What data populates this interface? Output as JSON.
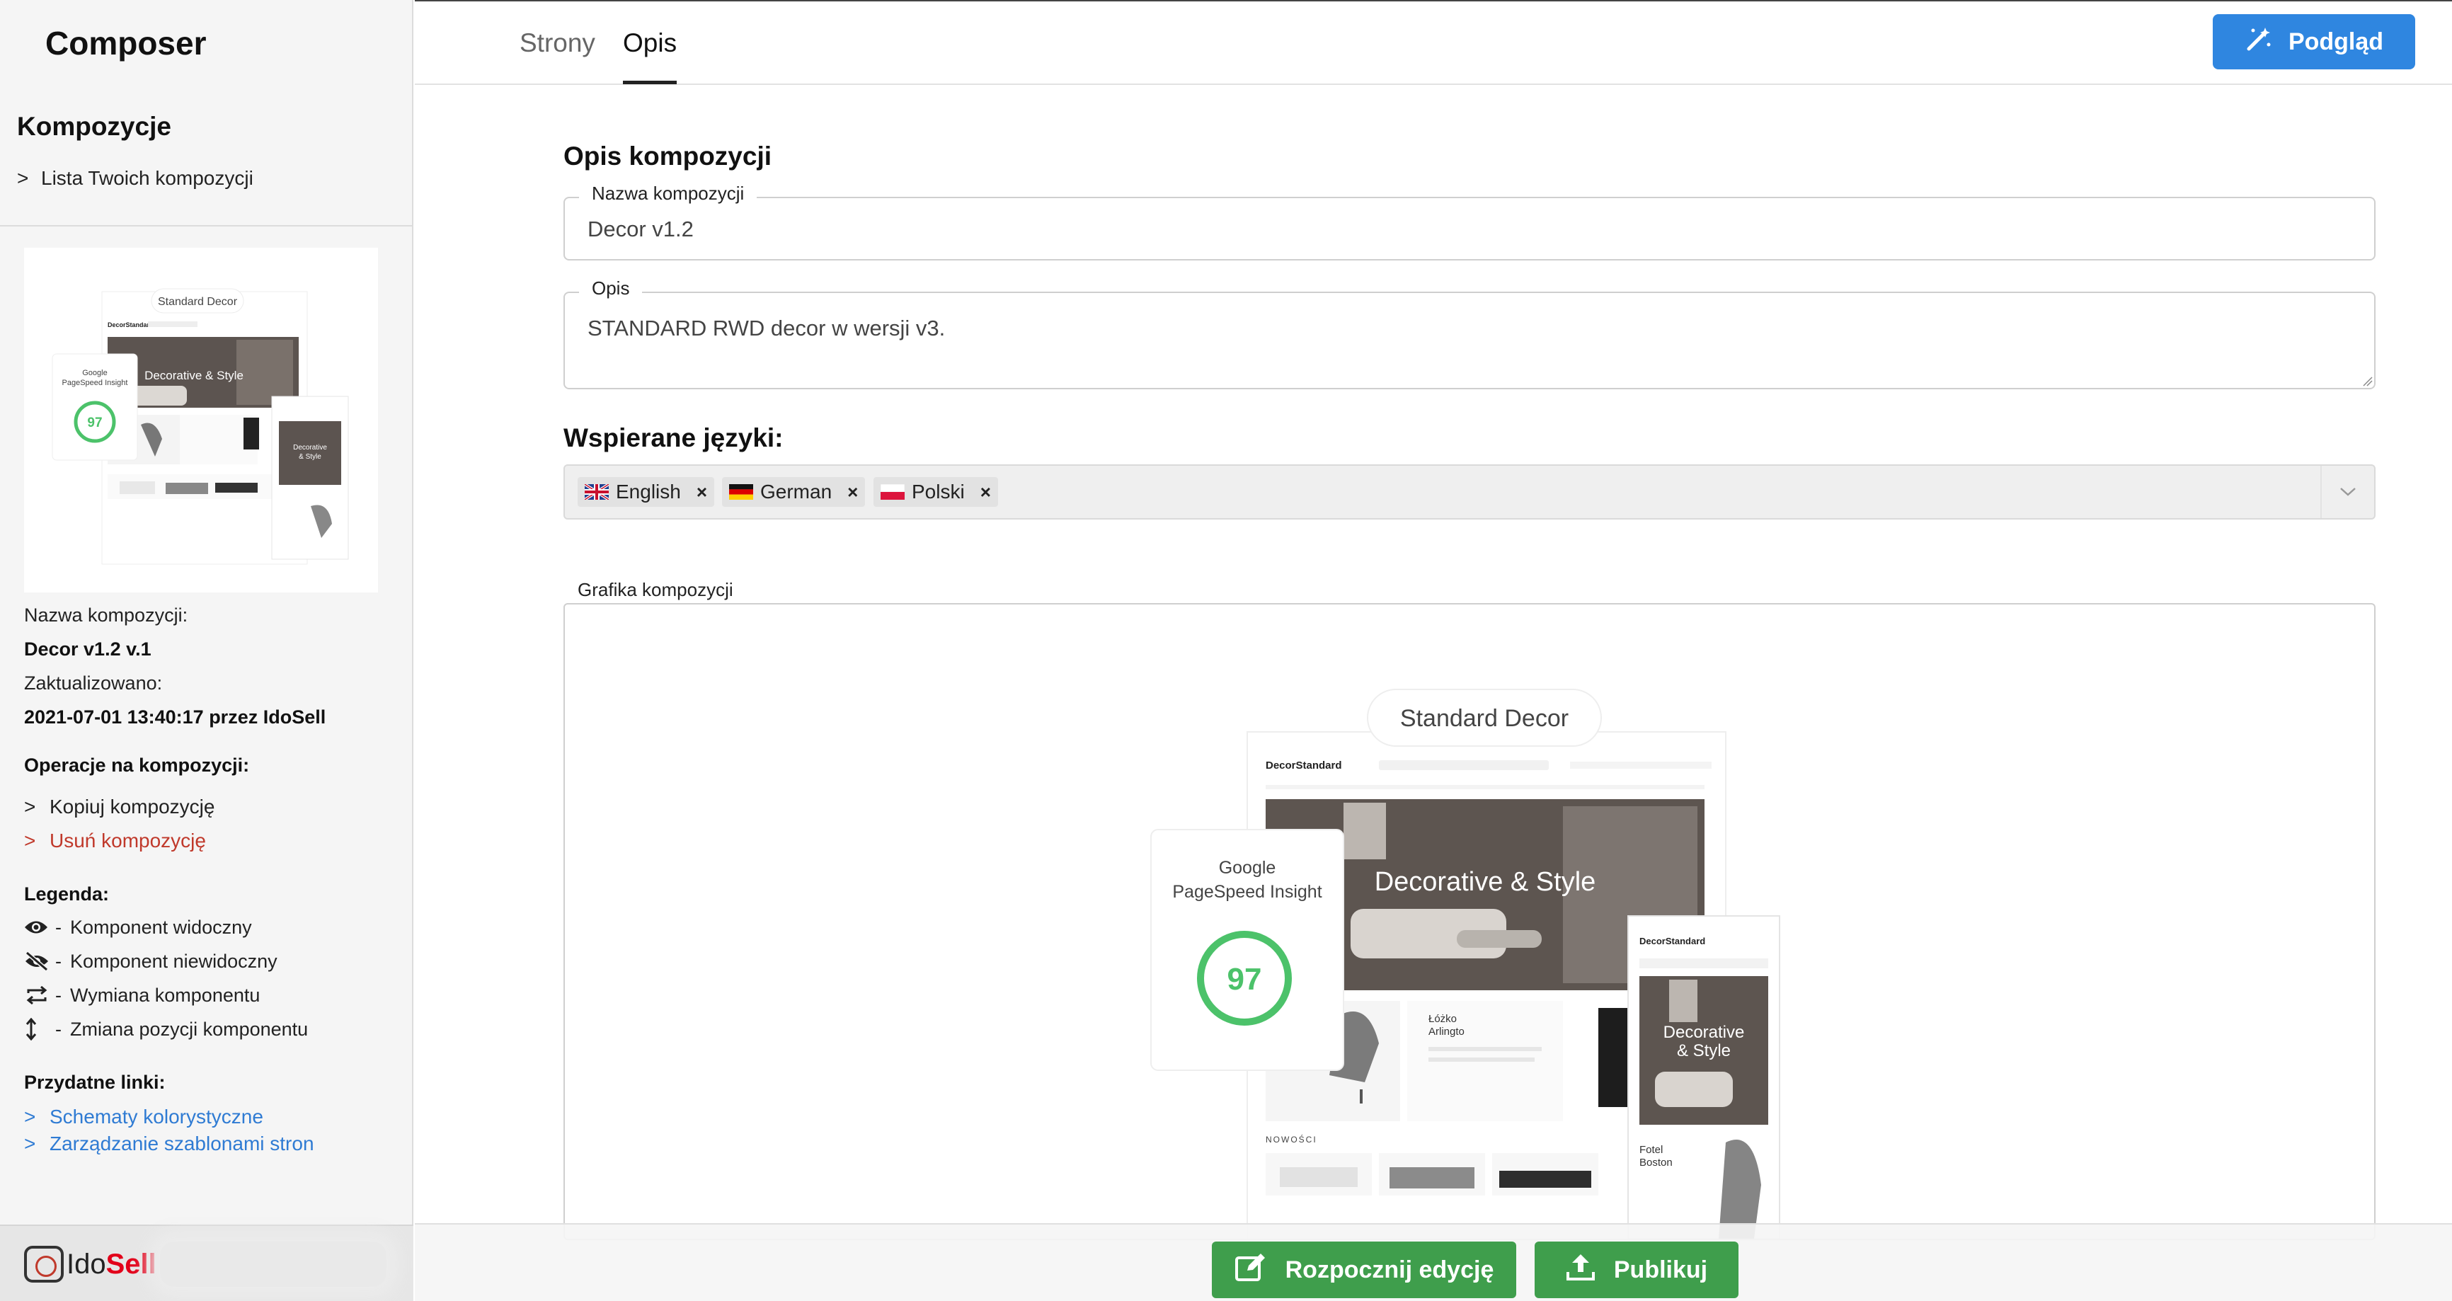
{
  "app": {
    "title": "Composer"
  },
  "sidebar": {
    "compositions_heading": "Kompozycje",
    "compositions_link": "Lista Twoich kompozycji",
    "thumbnail": {
      "title": "Standard Decor",
      "score_label_1": "Google",
      "score_label_2": "PageSpeed Insight",
      "score": "97",
      "hero_text": "Decorative & Style",
      "brand": "DecorStandard"
    },
    "name_label": "Nazwa kompozycji:",
    "name_value": "Decor v1.2 v.1",
    "updated_label": "Zaktualizowano:",
    "updated_value": "2021-07-01 13:40:17 przez IdoSell",
    "operations_heading": "Operacje na kompozycji:",
    "op_copy": "Kopiuj kompozycję",
    "op_delete": "Usuń kompozycję",
    "legend_heading": "Legenda:",
    "legend": [
      {
        "icon": "eye-icon",
        "text": "Komponent widoczny"
      },
      {
        "icon": "eye-slash-icon",
        "text": "Komponent niewidoczny"
      },
      {
        "icon": "swap-icon",
        "text": "Wymiana komponentu"
      },
      {
        "icon": "vertical-arrows-icon",
        "text": "Zmiana pozycji komponentu"
      }
    ],
    "links_heading": "Przydatne linki:",
    "link_colors": "Schematy kolorystyczne",
    "link_templates": "Zarządzanie szablonami stron",
    "logo_text_ido": "Ido",
    "logo_text_sell": "Sell"
  },
  "topbar": {
    "tabs": [
      {
        "label": "Strony"
      },
      {
        "label": "Opis"
      }
    ],
    "preview_label": "Podgląd"
  },
  "form": {
    "section_title": "Opis kompozycji",
    "name_legend": "Nazwa kompozycji",
    "name_value": "Decor v1.2",
    "desc_legend": "Opis",
    "desc_value": "STANDARD RWD decor w wersji v3.",
    "languages_title": "Wspierane języki:",
    "languages": [
      {
        "label": "English",
        "flag": "gb"
      },
      {
        "label": "German",
        "flag": "de"
      },
      {
        "label": "Polski",
        "flag": "pl"
      }
    ],
    "remove_mark": "×",
    "graphic_label": "Grafika kompozycji"
  },
  "preview_graphic": {
    "title": "Standard Decor",
    "brand": "DecorStandard",
    "score_label_1": "Google",
    "score_label_2": "PageSpeed Insight",
    "score": "97",
    "hero_text": "Decorative & Style",
    "mobile_hero_1": "Decorative",
    "mobile_hero_2": "& Style",
    "product_1": "Łóżko",
    "product_1b": "Arlingto",
    "product_2": "Fotel",
    "product_2b": "Boston",
    "section_new": "NOWOŚCI"
  },
  "actions": {
    "edit_label": "Rozpocznij edycję",
    "publish_label": "Publikuj"
  },
  "colors": {
    "primary_blue": "#2f86e0",
    "action_green": "#3f9e4c",
    "danger_red": "#c0392b",
    "link_blue": "#2f7bd3",
    "score_green": "#4cc26a"
  }
}
